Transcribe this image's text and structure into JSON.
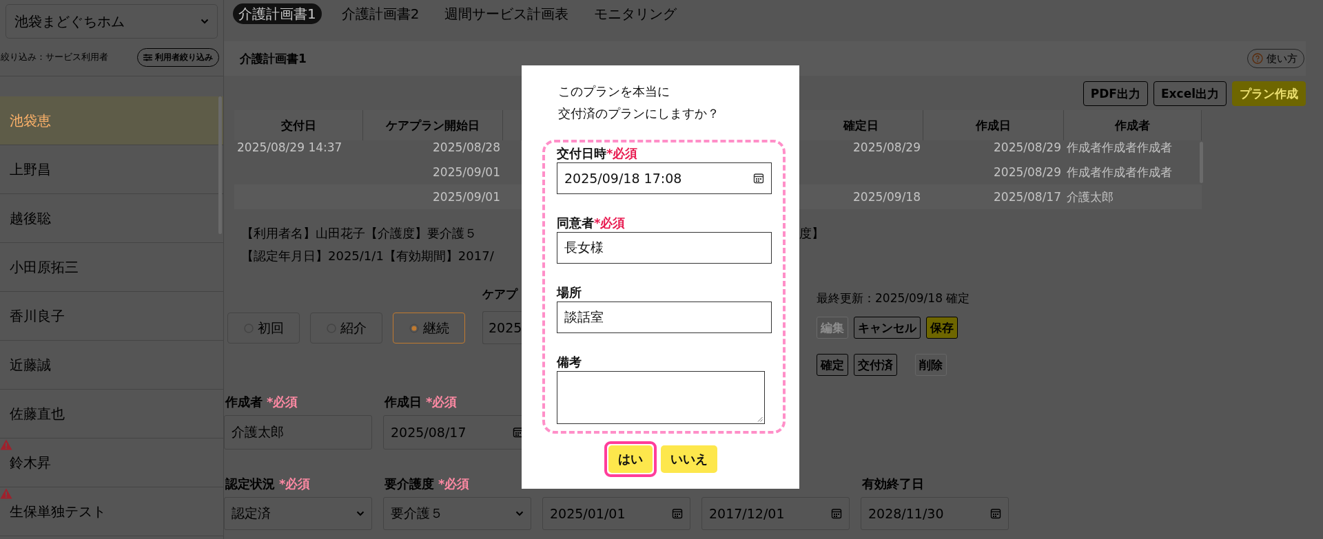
{
  "facility_select": {
    "value": "池袋まどぐちホム"
  },
  "filter": {
    "label": "絞り込み：サービス利用者",
    "button": "利用者絞り込み"
  },
  "patients": [
    {
      "name": "池袋恵",
      "selected": true,
      "warning": false
    },
    {
      "name": "上野昌",
      "selected": false,
      "warning": false
    },
    {
      "name": "越後聡",
      "selected": false,
      "warning": false
    },
    {
      "name": "小田原拓三",
      "selected": false,
      "warning": false
    },
    {
      "name": "香川良子",
      "selected": false,
      "warning": false
    },
    {
      "name": "近藤誠",
      "selected": false,
      "warning": false
    },
    {
      "name": "佐藤直也",
      "selected": false,
      "warning": false
    },
    {
      "name": "鈴木昇",
      "selected": false,
      "warning": true
    },
    {
      "name": "生保単独テスト",
      "selected": false,
      "warning": true
    }
  ],
  "tabs": [
    {
      "label": "介護計画書1",
      "selected": true
    },
    {
      "label": "介護計画書2",
      "selected": false
    },
    {
      "label": "週間サービス計画表",
      "selected": false
    },
    {
      "label": "モニタリング",
      "selected": false
    }
  ],
  "panel": {
    "title": "介護計画書1",
    "help_button": "使い方"
  },
  "actions": [
    {
      "label": "PDF出力",
      "kind": "outline"
    },
    {
      "label": "Excel出力",
      "kind": "outline"
    },
    {
      "label": "プラン作成",
      "kind": "primary"
    }
  ],
  "plan_table": {
    "columns_left": [
      "交付日",
      "ケアプラン開始日"
    ],
    "columns_right": [
      "確定日",
      "作成日",
      "作成者"
    ],
    "rows": [
      {
        "issue_date": "2025/08/29 14:37",
        "plan_start_date": "2025/08/28",
        "confirmed_date": "2025/08/29",
        "created_date": "2025/08/29",
        "author": "作成者作成者作成者"
      },
      {
        "plan_start_date": "2025/09/01",
        "created_date": "2025/08/29",
        "author": "作成者作成者作成者"
      },
      {
        "plan_start_date": "2025/09/01",
        "confirmed_date": "2025/09/18",
        "created_date": "2025/08/17",
        "author": "介護太郎"
      }
    ]
  },
  "summary": {
    "line_1": "【利用者名】山田花子【介護度】要介護５",
    "line_1_tail": "度】",
    "line_2": "【認定年月日】2025/1/1【有効期間】2017/"
  },
  "plan_type": [
    {
      "label": "初回",
      "selected": false
    },
    {
      "label": "紹介",
      "selected": false
    },
    {
      "label": "継続",
      "selected": true
    }
  ],
  "plan_start": {
    "label": "ケアプ",
    "value": "2025"
  },
  "last_updated": "最終更新：2025/09/18 確定",
  "edit_buttons": [
    {
      "label": "編集",
      "kind": "outline",
      "disabled": true
    },
    {
      "label": "キャンセル",
      "kind": "outline",
      "disabled": false
    },
    {
      "label": "保存",
      "kind": "primary",
      "disabled": false
    }
  ],
  "status_buttons": [
    {
      "label": "確定",
      "kind": "outline"
    },
    {
      "label": "交付済",
      "kind": "outline"
    },
    {
      "label": "削除",
      "kind": "plain"
    }
  ],
  "form_rows": [
    [
      {
        "kind": "text",
        "label": "作成者",
        "required": "*必須",
        "value": "介護太郎"
      },
      {
        "kind": "date",
        "label": "作成日",
        "required": "*必須",
        "value": "2025/08/17"
      }
    ],
    [
      {
        "kind": "select",
        "label": "認定状況",
        "required": "*必須",
        "value": "認定済"
      },
      {
        "kind": "select",
        "label": "要介護度",
        "required": "*必須",
        "value": "要介護５"
      },
      {
        "kind": "date",
        "value": "2025/01/01"
      },
      {
        "kind": "date",
        "value": "2017/12/01"
      },
      {
        "kind": "date",
        "label": "有効終了日",
        "value": "2028/11/30"
      }
    ]
  ],
  "dialog": {
    "message_lines": [
      "このプランを本当に",
      "交付済のプランにしますか？"
    ],
    "fields_highlighted": true,
    "fields": [
      {
        "kind": "date",
        "label": "交付日時",
        "required": "*必須",
        "value": "2025/09/18 17:08"
      },
      {
        "kind": "text",
        "label": "同意者",
        "required": "*必須",
        "value": "長女様"
      },
      {
        "kind": "text",
        "label": "場所",
        "value": "談話室"
      },
      {
        "kind": "textarea",
        "label": "備考"
      }
    ],
    "buttons": [
      {
        "label": "はい",
        "highlighted": true
      },
      {
        "label": "いいえ",
        "highlighted": false
      }
    ]
  }
}
